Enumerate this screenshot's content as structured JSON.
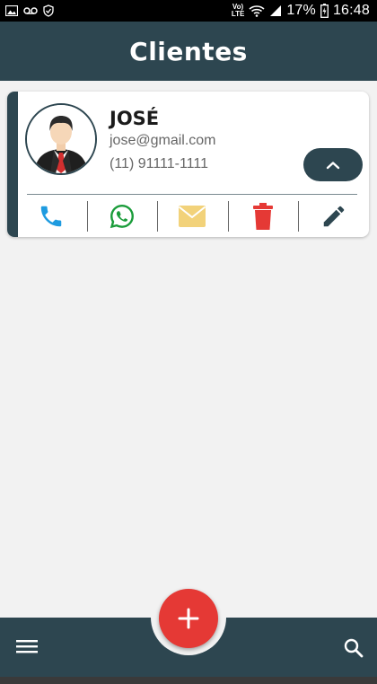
{
  "status_bar": {
    "volte": "Vo)",
    "lte": "LTE",
    "battery_percent": "17%",
    "time": "16:48",
    "icons": [
      "gallery-icon",
      "voicemail-icon",
      "shield-icon",
      "wifi-icon",
      "signal-icon",
      "battery-icon"
    ]
  },
  "header": {
    "title": "Clientes"
  },
  "clients": [
    {
      "name": "JOSÉ",
      "email": "jose@gmail.com",
      "phone": "(11) 91111-1111",
      "actions": [
        "phone-icon",
        "whatsapp-icon",
        "email-icon",
        "delete-icon",
        "edit-icon"
      ]
    }
  ],
  "colors": {
    "primary": "#2d4650",
    "fab": "#e53935",
    "phone": "#1e9be0",
    "whatsapp": "#1a9c3a",
    "mail": "#f2d27a",
    "delete": "#e53935",
    "edit": "#2d4650"
  },
  "bottom_bar": {
    "icons": [
      "menu-icon",
      "add-icon",
      "search-icon"
    ]
  }
}
